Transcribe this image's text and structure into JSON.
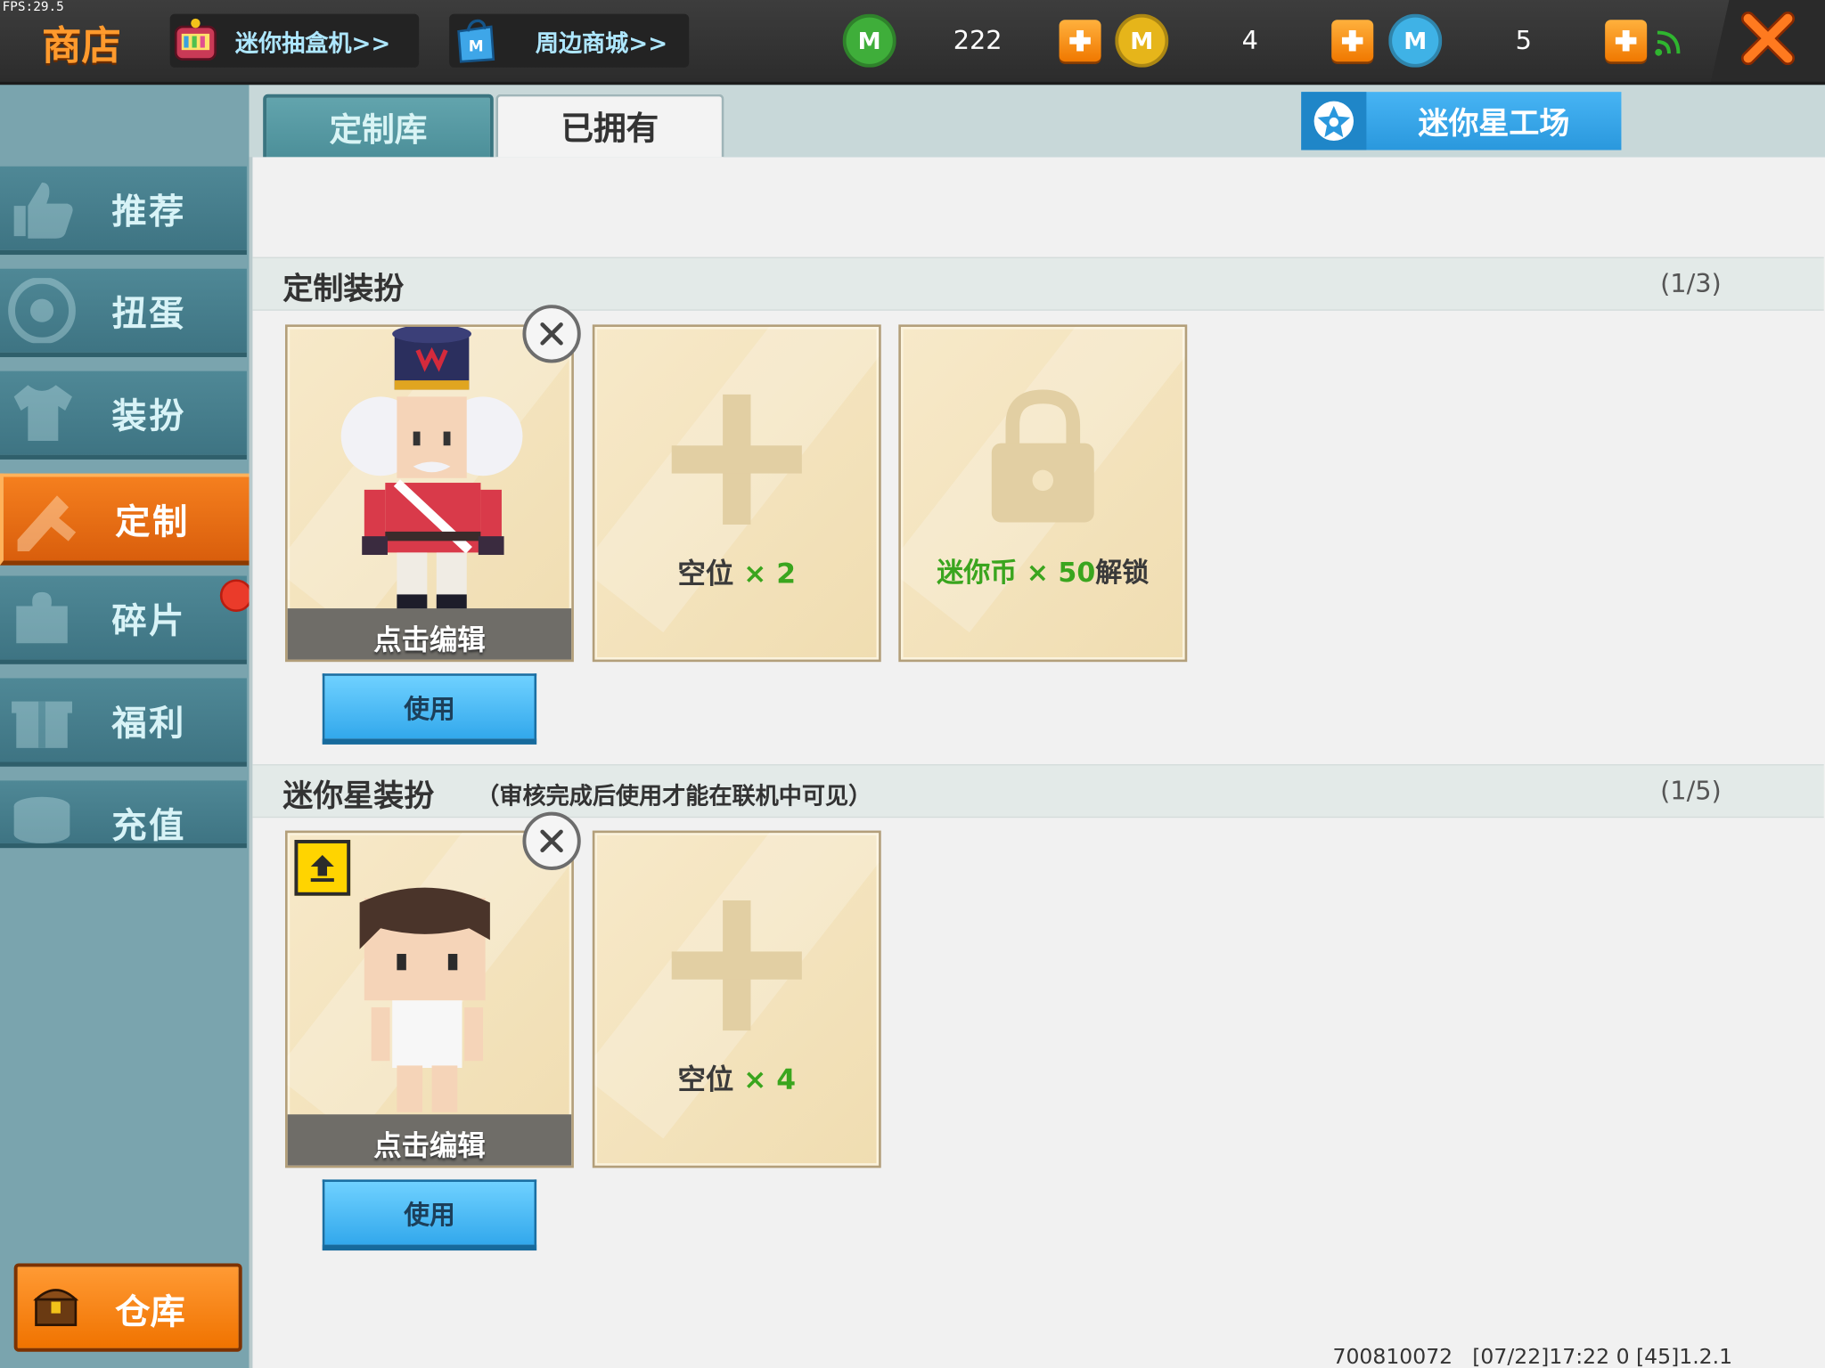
{
  "debug": {
    "fps": "FPS:29.5"
  },
  "header": {
    "title": "商店",
    "links": [
      {
        "label": "迷你抽盒机>>"
      },
      {
        "label": "周边商城>>"
      }
    ],
    "currencies": [
      {
        "name": "mini-bean",
        "value": "222",
        "color": "#3fae3a"
      },
      {
        "name": "mini-coin",
        "value": "4",
        "color": "#e6b51a"
      },
      {
        "name": "mini-point",
        "value": "5",
        "color": "#3fb2e6"
      }
    ]
  },
  "sidebar": {
    "items": [
      {
        "label": "推荐"
      },
      {
        "label": "扭蛋"
      },
      {
        "label": "装扮"
      },
      {
        "label": "定制",
        "active": true
      },
      {
        "label": "碎片",
        "badge": true
      },
      {
        "label": "福利"
      },
      {
        "label": "充值"
      }
    ],
    "warehouse": "仓库"
  },
  "tabs": {
    "items": [
      {
        "label": "定制库",
        "active": false
      },
      {
        "label": "已拥有",
        "active": true
      }
    ],
    "star_factory": "迷你星工场"
  },
  "sections": {
    "custom": {
      "title": "定制装扮",
      "count": "(1/3)",
      "edit_label": "点击编辑",
      "use_label": "使用",
      "empty_label": "空位",
      "empty_mult": "× 2",
      "locked_label": "迷你币 × 50",
      "locked_suffix": "解锁"
    },
    "star": {
      "title": "迷你星装扮",
      "note": "（审核完成后使用才能在联机中可见）",
      "count": "(1/5)",
      "edit_label": "点击编辑",
      "use_label": "使用",
      "empty_label": "空位",
      "empty_mult": "× 4"
    }
  },
  "footer": {
    "id": "700810072",
    "timestamp": "[07/22]17:22 0 [45]1.2.1"
  }
}
